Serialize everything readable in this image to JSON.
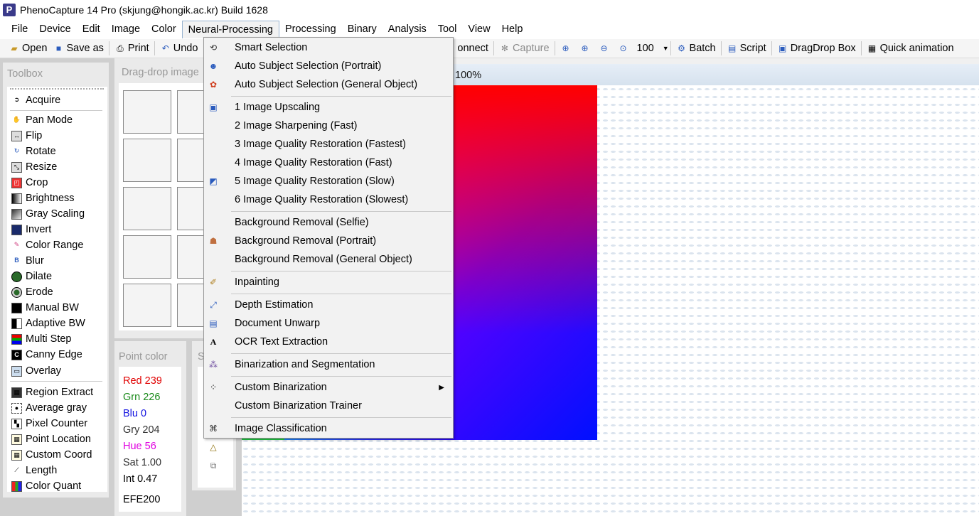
{
  "window": {
    "app_icon_letter": "P",
    "title": "PhenoCapture 14 Pro (skjung@hongik.ac.kr)  Build 1628"
  },
  "menubar": [
    "File",
    "Device",
    "Edit",
    "Image",
    "Color",
    "Neural-Processing",
    "Processing",
    "Binary",
    "Analysis",
    "Tool",
    "View",
    "Help"
  ],
  "toolbar": {
    "open": "Open",
    "save_as": "Save as",
    "print": "Print",
    "undo": "Undo",
    "connect": "onnect",
    "capture": "Capture",
    "zoom_value": "100",
    "batch": "Batch",
    "script": "Script",
    "dragdrop_box": "DragDrop Box",
    "quick_animation": "Quick animation"
  },
  "toolbox": {
    "title": "Toolbox",
    "tools": [
      "Acquire",
      "Pan Mode",
      "Flip",
      "Rotate",
      "Resize",
      "Crop",
      "Brightness",
      "Gray Scaling",
      "Invert",
      "Color Range",
      "Blur",
      "Dilate",
      "Erode",
      "Manual BW",
      "Adaptive BW",
      "Multi Step",
      "Canny Edge",
      "Overlay",
      "Region Extract",
      "Average gray",
      "Pixel Counter",
      "Point Location",
      "Custom Coord",
      "Length",
      "Color Quant"
    ]
  },
  "dragdrop": {
    "title": "Drag-drop image"
  },
  "point_color": {
    "title": "Point color",
    "red": "Red 239",
    "grn": "Grn 226",
    "blu": "Blu 0",
    "gry": "Gry 204",
    "hue": "Hue 56",
    "sat": "Sat 1.00",
    "int": "Int 0.47",
    "hex": "EFE200"
  },
  "panel3": {
    "title": "S"
  },
  "image_view": {
    "zoom_label": "100%"
  },
  "neural_menu": {
    "items": [
      "Smart Selection",
      "Auto Subject Selection (Portrait)",
      "Auto Subject Selection (General Object)",
      "1 Image Upscaling",
      "2 Image Sharpening (Fast)",
      "3 Image Quality Restoration (Fastest)",
      "4 Image Quality Restoration (Fast)",
      "5 Image Quality Restoration (Slow)",
      "6 Image Quality Restoration (Slowest)",
      "Background Removal (Selfie)",
      "Background Removal (Portrait)",
      "Background Removal (General Object)",
      "Inpainting",
      "Depth Estimation",
      "Document Unwarp",
      "OCR Text Extraction",
      "Binarization and Segmentation",
      "Custom Binarization",
      "Custom Binarization Trainer",
      "Image Classification"
    ]
  },
  "colors": {
    "red_text": "#e00000",
    "green_text": "#1a8a1a",
    "blue_text": "#1010e0",
    "hue_text": "#e000e0",
    "menu_highlight_border": "#99b4d1"
  }
}
